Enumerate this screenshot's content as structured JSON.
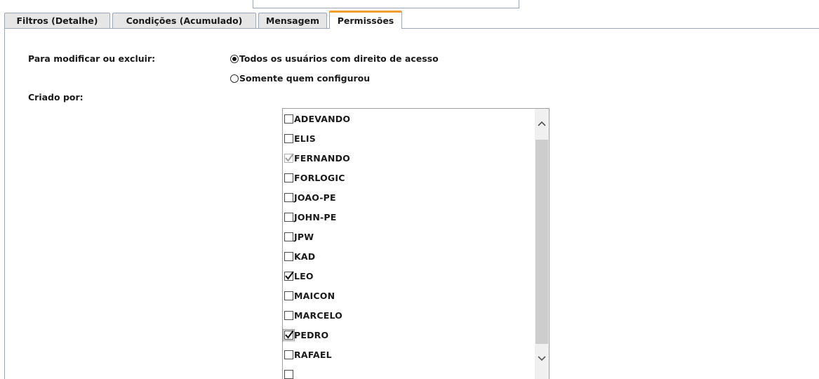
{
  "tabs": [
    {
      "label": "Filtros (Detalhe)",
      "active": false
    },
    {
      "label": "Condições (Acumulado)",
      "active": false
    },
    {
      "label": "Mensagem",
      "active": false
    },
    {
      "label": "Permissões",
      "active": true
    }
  ],
  "permissions": {
    "modify_label": "Para modificar ou excluir:",
    "options": [
      {
        "label": "Todos os usuários com direito de acesso",
        "selected": true
      },
      {
        "label": "Somente quem configurou",
        "selected": false
      }
    ],
    "created_by_label": "Criado por:"
  },
  "users": [
    {
      "name": "ADEVANDO",
      "checked": false,
      "disabled": false
    },
    {
      "name": "ELIS",
      "checked": false,
      "disabled": false
    },
    {
      "name": "FERNANDO",
      "checked": true,
      "disabled": true
    },
    {
      "name": "FORLOGIC",
      "checked": false,
      "disabled": false
    },
    {
      "name": "JOAO-PE",
      "checked": false,
      "disabled": false
    },
    {
      "name": "JOHN-PE",
      "checked": false,
      "disabled": false
    },
    {
      "name": "JPW",
      "checked": false,
      "disabled": false
    },
    {
      "name": "KAD",
      "checked": false,
      "disabled": false
    },
    {
      "name": "LEO",
      "checked": true,
      "disabled": false
    },
    {
      "name": "MAICON",
      "checked": false,
      "disabled": false
    },
    {
      "name": "MARCELO",
      "checked": false,
      "disabled": false
    },
    {
      "name": "PEDRO",
      "checked": true,
      "disabled": false,
      "focused": true
    },
    {
      "name": "RAFAEL",
      "checked": false,
      "disabled": false
    },
    {
      "name": "",
      "checked": false,
      "disabled": false
    }
  ],
  "icons": {
    "scroll_up": "chevron-up-icon",
    "scroll_down": "chevron-down-icon",
    "check": "check-icon"
  },
  "colors": {
    "active_tab_accent": "#f0a030",
    "border": "#9aa7b8"
  }
}
